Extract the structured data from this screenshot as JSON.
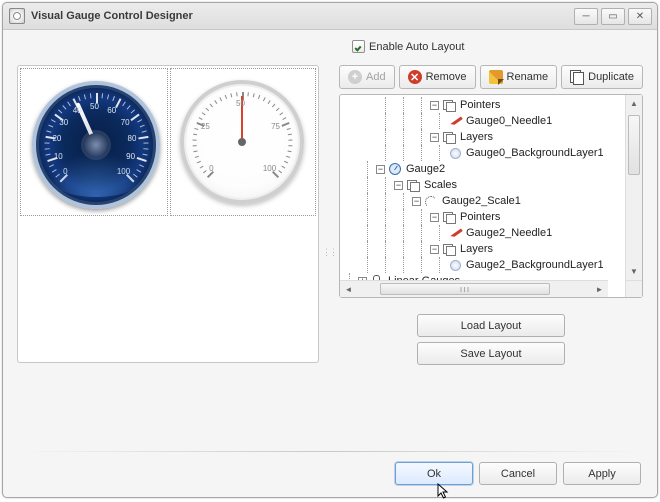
{
  "window": {
    "title": "Visual Gauge Control Designer"
  },
  "auto_layout": {
    "label": "Enable Auto Layout",
    "checked": true
  },
  "toolbar": {
    "add": "Add",
    "remove": "Remove",
    "rename": "Rename",
    "duplicate": "Duplicate"
  },
  "tree": {
    "nodes": {
      "pointers0": "Pointers",
      "needle0": "Gauge0_Needle1",
      "layers0": "Layers",
      "bg0": "Gauge0_BackgroundLayer1",
      "gauge2": "Gauge2",
      "scales2": "Scales",
      "scale2_1": "Gauge2_Scale1",
      "pointers2": "Pointers",
      "needle2": "Gauge2_Needle1",
      "layers2": "Layers",
      "bg2": "Gauge2_BackgroundLayer1",
      "linear": "Linear Gauges"
    }
  },
  "layout_btns": {
    "load": "Load Layout",
    "save": "Save Layout"
  },
  "dialog": {
    "ok": "Ok",
    "cancel": "Cancel",
    "apply": "Apply"
  },
  "gauge1_numbers": [
    "0",
    "10",
    "20",
    "30",
    "40",
    "50",
    "60",
    "70",
    "80",
    "90",
    "100"
  ],
  "gauge2_numbers": [
    "0",
    "25",
    "50",
    "75",
    "100"
  ]
}
